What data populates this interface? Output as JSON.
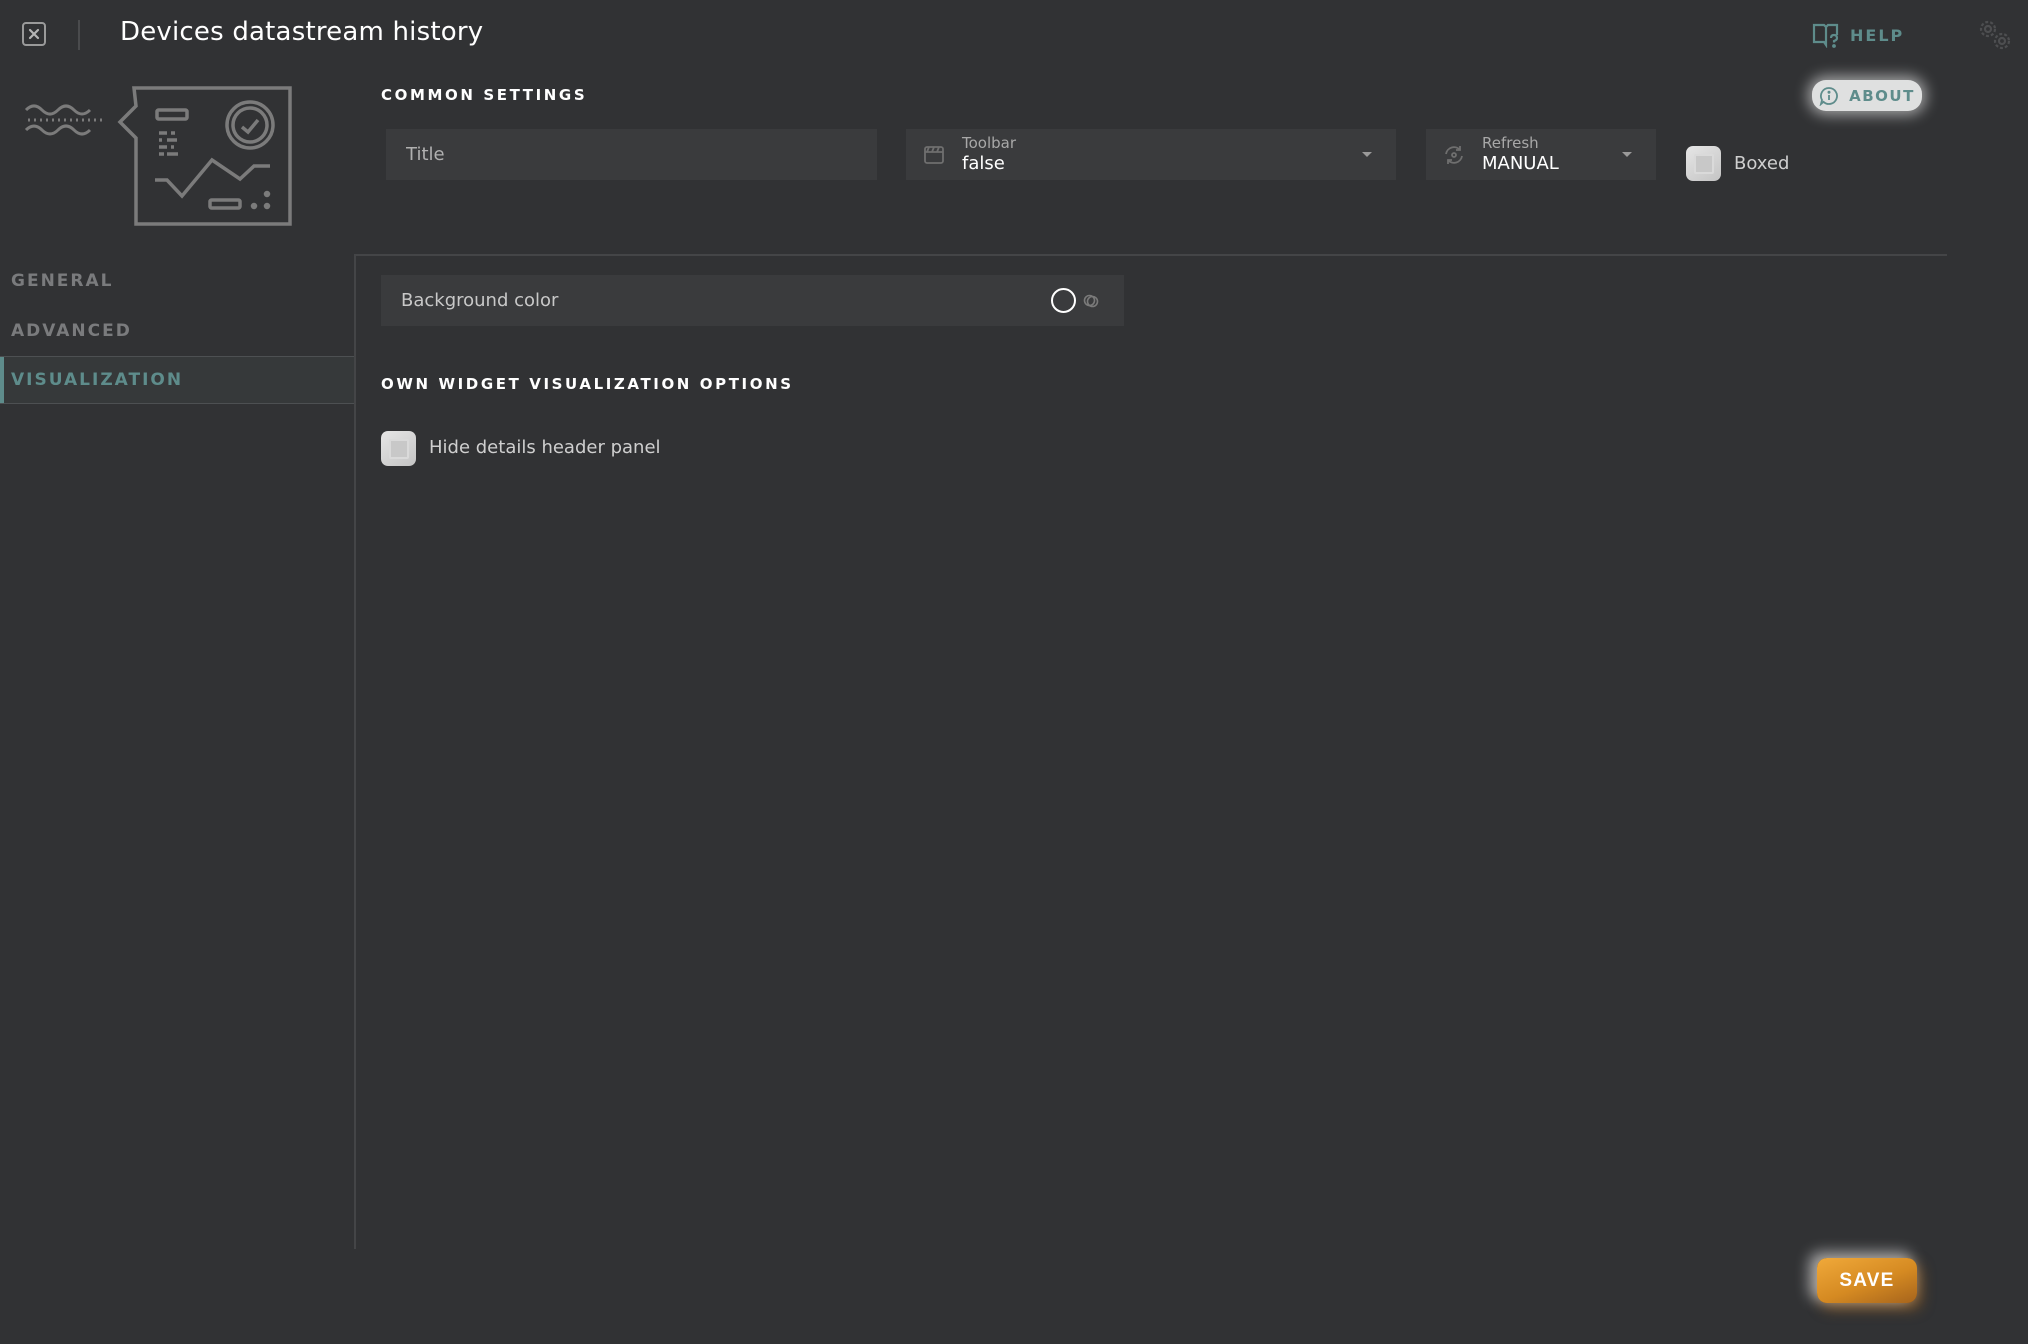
{
  "header": {
    "title": "Devices datastream history",
    "help_label": "HELP",
    "close_icon": "close-icon",
    "settings_icon": "gears-icon"
  },
  "sidebar": {
    "items": [
      {
        "label": "GENERAL",
        "active": false
      },
      {
        "label": "ADVANCED",
        "active": false
      },
      {
        "label": "VISUALIZATION",
        "active": true
      }
    ]
  },
  "common_settings": {
    "heading": "COMMON SETTINGS",
    "about_label": "ABOUT",
    "title_field": {
      "placeholder": "Title",
      "value": ""
    },
    "toolbar": {
      "label": "Toolbar",
      "value": "false",
      "icon": "toolbar-icon"
    },
    "refresh": {
      "label": "Refresh",
      "value": "MANUAL",
      "icon": "refresh-icon"
    },
    "boxed": {
      "label": "Boxed",
      "checked": false
    }
  },
  "visualization": {
    "background_color": {
      "label": "Background color",
      "value": "#ffffff"
    },
    "own_options_heading": "OWN WIDGET VISUALIZATION OPTIONS",
    "hide_details_header": {
      "label": "Hide details header panel",
      "checked": false
    }
  },
  "footer": {
    "save_label": "SAVE"
  },
  "colors": {
    "background": "#313234",
    "accent": "#5e8c8b",
    "save": "#e0962e"
  }
}
